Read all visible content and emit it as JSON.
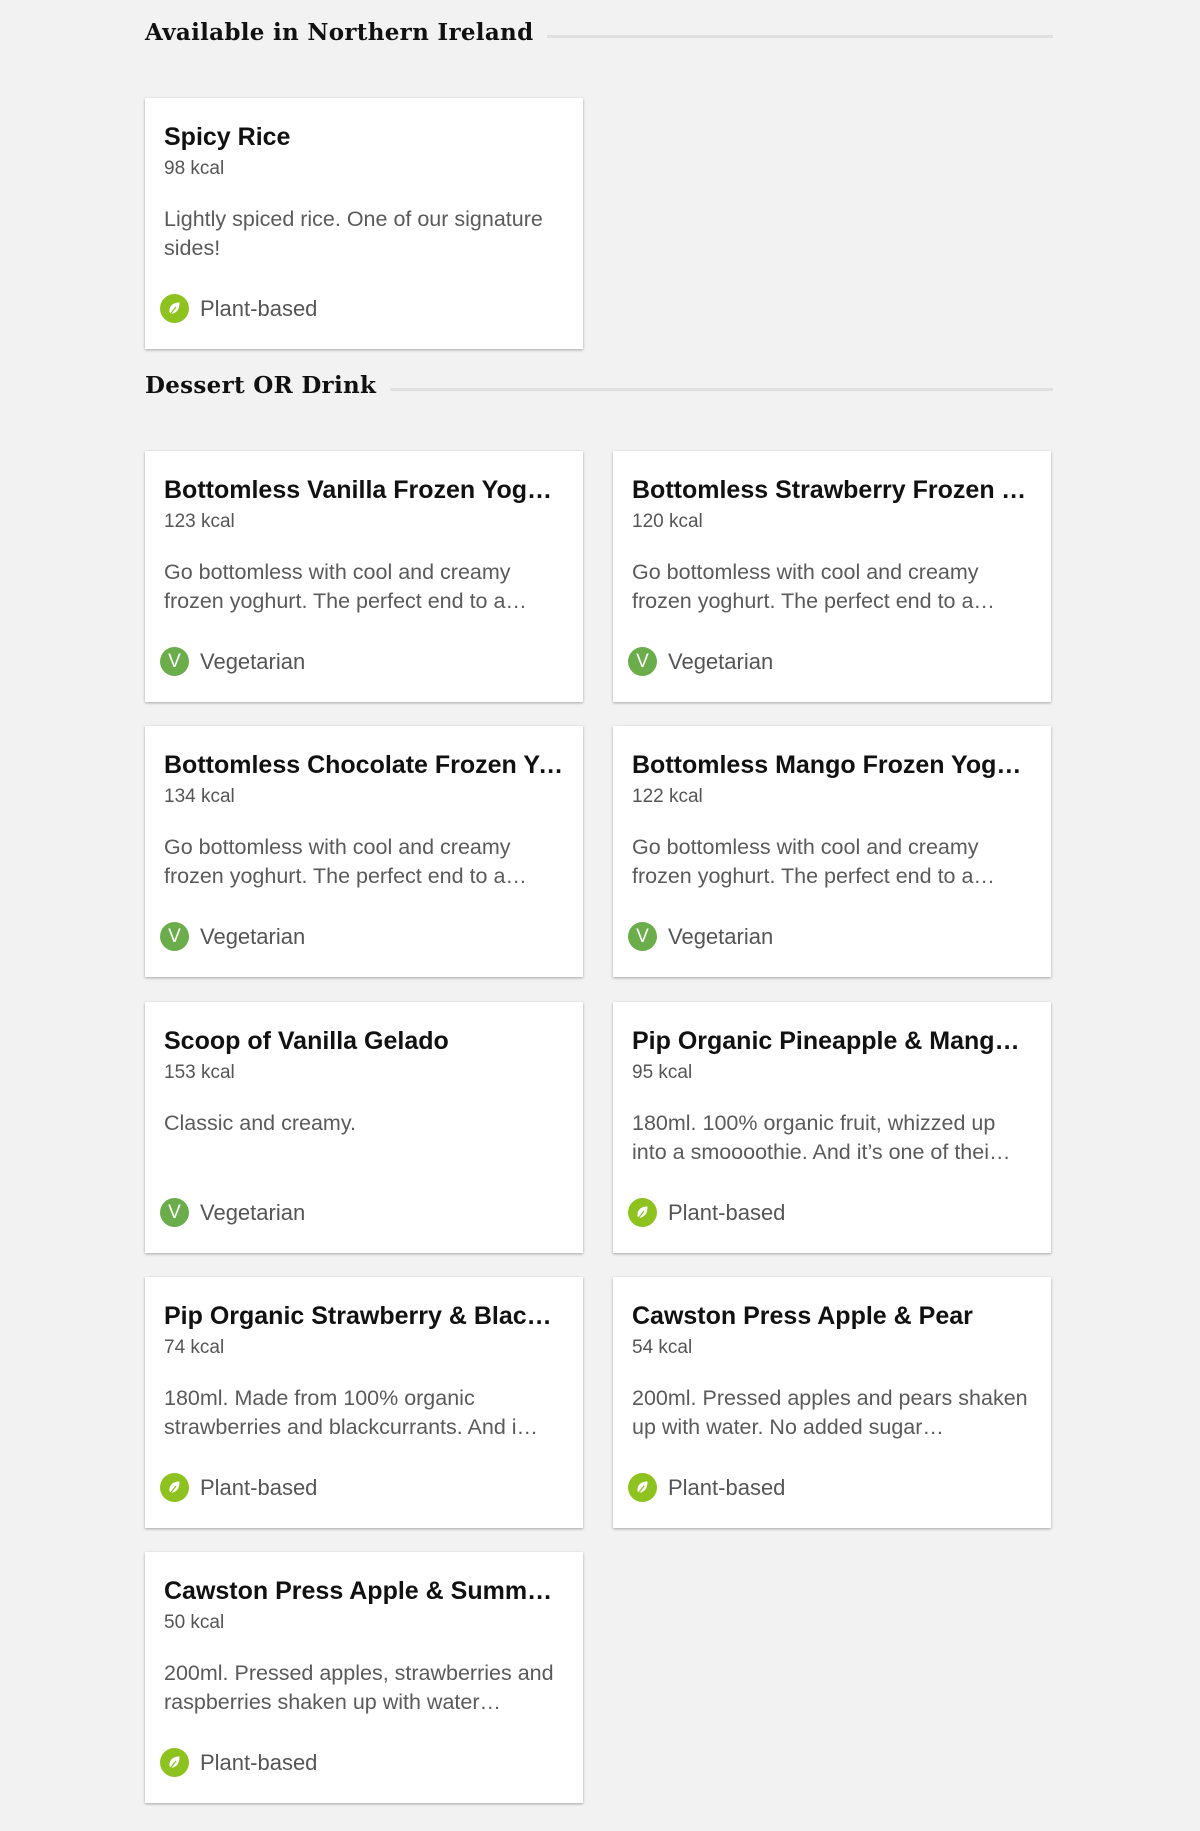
{
  "sections": [
    {
      "title": "Available in Northern Ireland",
      "items": [
        {
          "name": "Spicy Rice",
          "kcal": "98 kcal",
          "desc": "Lightly spiced rice. One of our signature sides!",
          "tag": "Plant-based",
          "tag_type": "plant-icon"
        }
      ]
    },
    {
      "title": "Dessert OR Drink",
      "items": [
        {
          "name": "Bottomless Vanilla Frozen Yoghurt",
          "kcal": "123 kcal",
          "desc": "Go bottomless with cool and creamy frozen yoghurt. The perfect end to a…",
          "tag": "Vegetarian",
          "tag_type": "vegetarian-icon"
        },
        {
          "name": "Bottomless Strawberry Frozen Y…",
          "kcal": "120 kcal",
          "desc": "Go bottomless with cool and creamy frozen yoghurt. The perfect end to a…",
          "tag": "Vegetarian",
          "tag_type": "vegetarian-icon"
        },
        {
          "name": "Bottomless Chocolate Frozen Yo…",
          "kcal": "134 kcal",
          "desc": "Go bottomless with cool and creamy frozen yoghurt. The perfect end to a…",
          "tag": "Vegetarian",
          "tag_type": "vegetarian-icon"
        },
        {
          "name": "Bottomless Mango Frozen Yoghurt",
          "kcal": "122 kcal",
          "desc": "Go bottomless with cool and creamy frozen yoghurt. The perfect end to a…",
          "tag": "Vegetarian",
          "tag_type": "vegetarian-icon"
        },
        {
          "name": "Scoop of Vanilla Gelado",
          "kcal": "153 kcal",
          "desc": "Classic and creamy.",
          "tag": "Vegetarian",
          "tag_type": "vegetarian-icon"
        },
        {
          "name": "Pip Organic Pineapple & Mango S…",
          "kcal": "95 kcal",
          "desc": "180ml. 100% organic fruit, whizzed up into a smoooothie. And it’s one of thei…",
          "tag": "Plant-based",
          "tag_type": "plant-icon"
        },
        {
          "name": "Pip Organic Strawberry & Blackc…",
          "kcal": "74 kcal",
          "desc": "180ml. Made from 100% organic strawberries and blackcurrants. And i…",
          "tag": "Plant-based",
          "tag_type": "plant-icon"
        },
        {
          "name": "Cawston Press Apple & Pear",
          "kcal": "54 kcal",
          "desc": "200ml. Pressed apples and pears shaken up with water. No added sugar…",
          "tag": "Plant-based",
          "tag_type": "plant-icon"
        },
        {
          "name": "Cawston Press Apple & Summer …",
          "kcal": "50 kcal",
          "desc": "200ml. Pressed apples, strawberries and raspberries shaken up with water…",
          "tag": "Plant-based",
          "tag_type": "plant-icon"
        }
      ]
    }
  ],
  "vegetarian_symbol": "V",
  "colors": {
    "background": "#f2f2f2",
    "card": "#ffffff",
    "vegetarian": "#6aad4a",
    "plant_based": "#8dc21f"
  }
}
